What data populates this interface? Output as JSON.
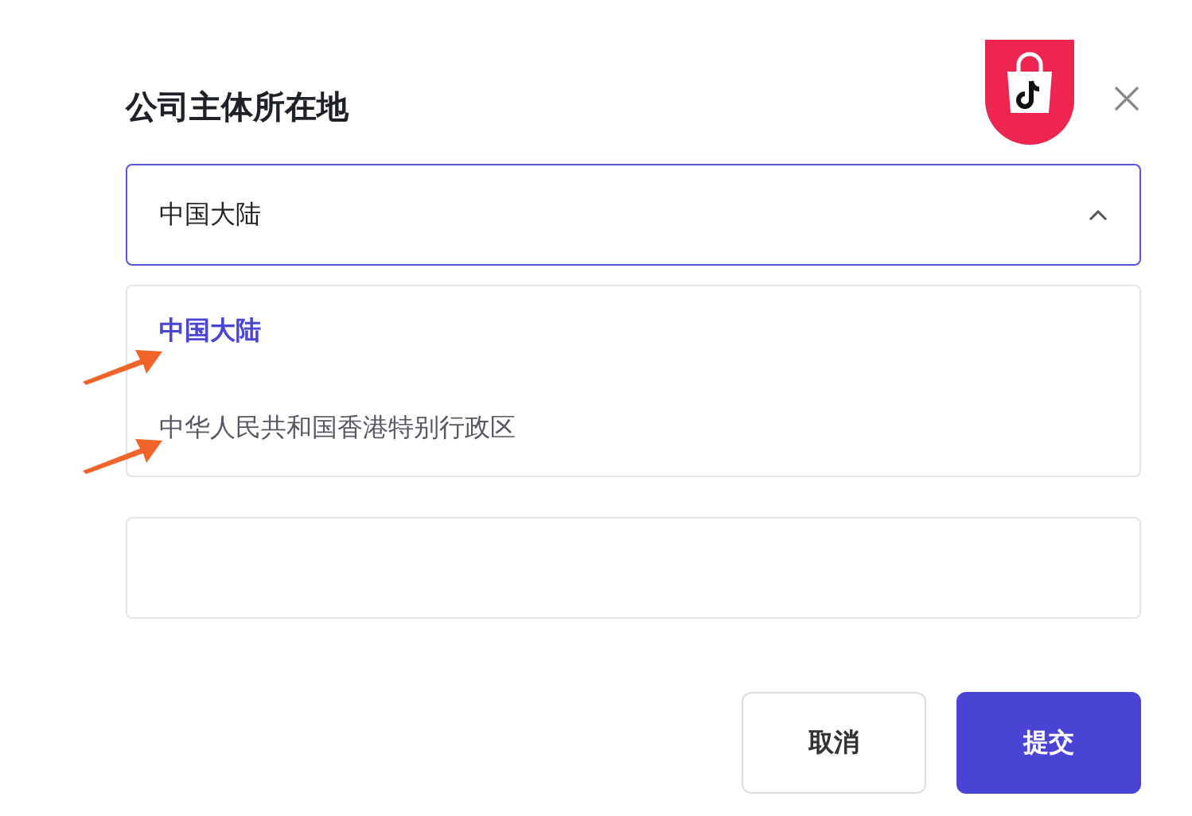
{
  "dialog": {
    "title": "公司主体所在地"
  },
  "select": {
    "value": "中国大陆",
    "expanded": true
  },
  "options": [
    {
      "label": "中国大陆",
      "selected": true
    },
    {
      "label": "中华人民共和国香港特别行政区",
      "selected": false
    }
  ],
  "buttons": [
    {
      "label": "取消",
      "kind": "secondary"
    },
    {
      "label": "提交",
      "kind": "primary"
    }
  ]
}
